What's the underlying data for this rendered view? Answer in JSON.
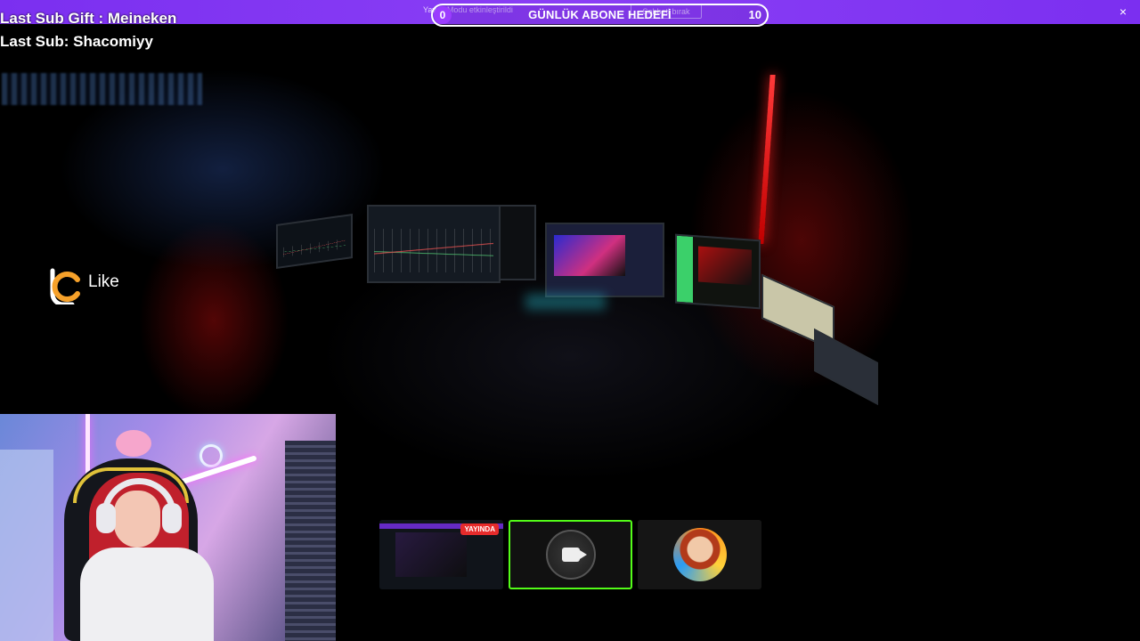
{
  "banner": {
    "note_text": "Yavaş Modu etkinleştirildi",
    "button_label": "Sohbeti bırak",
    "close_icon": "close-icon"
  },
  "goal": {
    "current": "0",
    "title": "GÜNLÜK ABONE HEDEFİ",
    "target": "10",
    "accent_color": "#9b3cff"
  },
  "subs": {
    "last_gift": "Last Sub Gift : Meineken",
    "last_sub": "Last Sub: Shacomiyy"
  },
  "like_widget": {
    "label": "Like",
    "icon": "like-logo-icon"
  },
  "thumbnails": [
    {
      "kind": "stream-preview",
      "badge": "YAYINDA",
      "badge_color": "#e62b2b"
    },
    {
      "kind": "camera",
      "icon": "video-camera-icon",
      "selected": true,
      "highlight_color": "#53fc18"
    },
    {
      "kind": "avatar",
      "icon": "avatar-icon"
    }
  ],
  "colors": {
    "banner": "#7b2ff0",
    "background": "#000000"
  }
}
